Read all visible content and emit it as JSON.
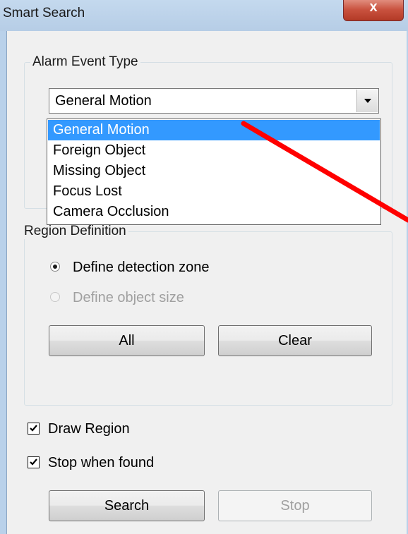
{
  "window": {
    "title": "Smart Search",
    "close_glyph": "x"
  },
  "alarm_event_type": {
    "group_label": "Alarm Event Type",
    "selected_value": "General Motion",
    "options": [
      "General Motion",
      "Foreign Object",
      "Missing Object",
      "Focus Lost",
      "Camera Occlusion"
    ],
    "highlighted_index": 0
  },
  "region_definition": {
    "group_label": "Region Definition",
    "radio_detection_zone": "Define detection zone",
    "radio_object_size": "Define object size",
    "all_button": "All",
    "clear_button": "Clear"
  },
  "options": {
    "draw_region": "Draw Region",
    "stop_when_found": "Stop when found"
  },
  "actions": {
    "search_button": "Search",
    "stop_button": "Stop"
  },
  "colors": {
    "selection": "#3399ff",
    "annotation_arrow": "#ff0000"
  }
}
